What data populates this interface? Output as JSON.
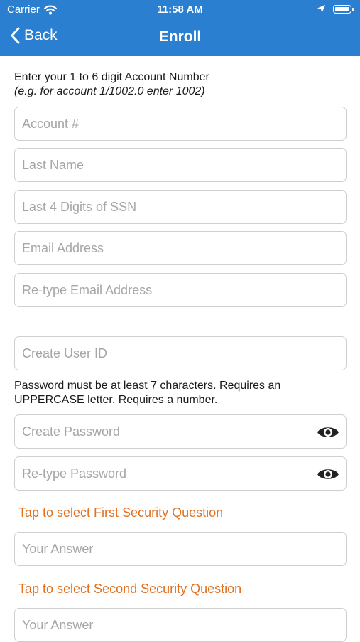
{
  "status_bar": {
    "carrier": "Carrier",
    "time": "11:58 AM"
  },
  "nav": {
    "back_label": "Back",
    "title": "Enroll"
  },
  "account_instructions": {
    "line1": "Enter your 1 to 6 digit Account Number",
    "line2": "(e.g. for account 1/1002.0 enter 1002)"
  },
  "fields": {
    "account": {
      "placeholder": "Account #"
    },
    "last_name": {
      "placeholder": "Last Name"
    },
    "ssn": {
      "placeholder": "Last 4 Digits of SSN"
    },
    "email": {
      "placeholder": "Email Address"
    },
    "email_retype": {
      "placeholder": "Re-type Email Address"
    },
    "user_id": {
      "placeholder": "Create User ID"
    },
    "password": {
      "placeholder": "Create Password"
    },
    "password_retype": {
      "placeholder": "Re-type Password"
    },
    "answer1": {
      "placeholder": "Your Answer"
    },
    "answer2": {
      "placeholder": "Your Answer"
    }
  },
  "password_rules": {
    "line1": "Password must be at least 7 characters. Requires an",
    "line2": "UPPERCASE letter. Requires a number."
  },
  "security": {
    "first_label": "Tap to select First Security Question",
    "second_label": "Tap to select Second Security Question"
  },
  "icons": {
    "back": "chevron-left-icon",
    "wifi": "wifi-icon",
    "location": "location-arrow-icon",
    "battery": "battery-icon",
    "eye": "eye-icon"
  },
  "colors": {
    "header": "#2a7fd0",
    "link": "#e2701f",
    "border": "#cfcfcf"
  }
}
